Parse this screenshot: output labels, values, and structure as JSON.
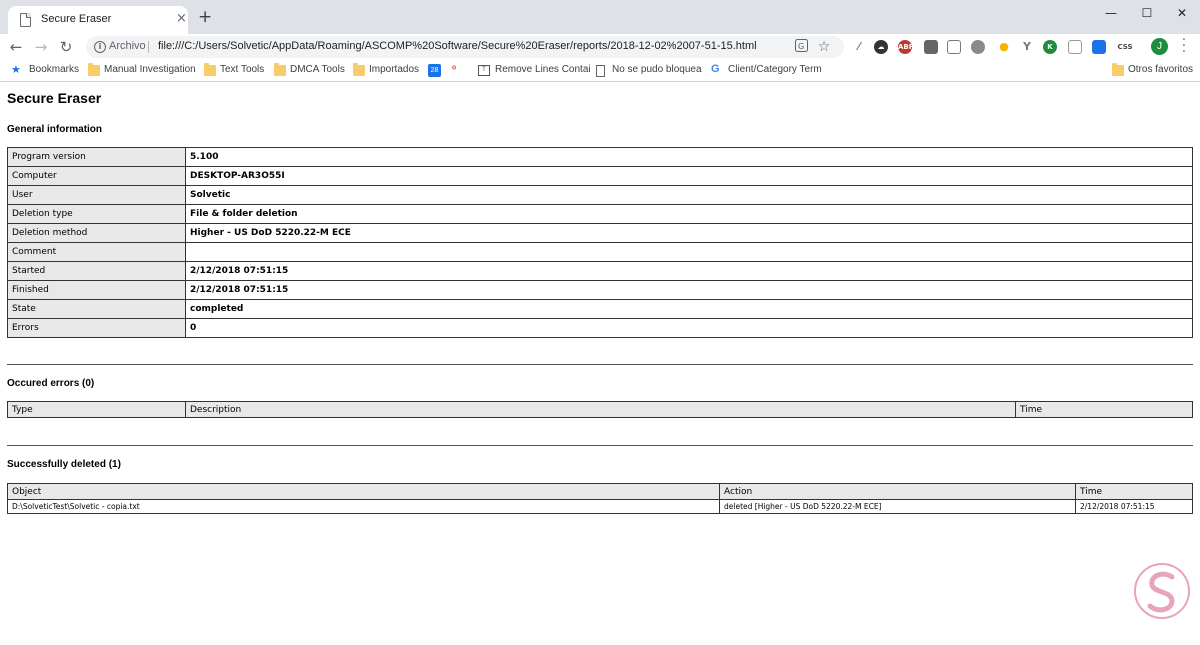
{
  "browser": {
    "tab_title": "Secure Eraser",
    "tab_close": "×",
    "new_tab": "+",
    "window_minimize": "—",
    "window_maximize": "☐",
    "window_close": "✕",
    "back": "←",
    "forward": "→",
    "reload": "↻",
    "url_scheme_label": "Archivo",
    "url": "file:///C:/Users/Solvetic/AppData/Roaming/ASCOMP%20Software/Secure%20Eraser/reports/2018-12-02%2007-51-15.html",
    "avatar_initial": "J",
    "extensions": [
      "ABP",
      "CSS"
    ]
  },
  "bookmarks": {
    "items": [
      {
        "label": "Bookmarks",
        "icon": "star-icon"
      },
      {
        "label": "Manual Investigation",
        "icon": "folder-icon"
      },
      {
        "label": "Text Tools",
        "icon": "folder-icon"
      },
      {
        "label": "DMCA Tools",
        "icon": "folder-icon"
      },
      {
        "label": "Importados",
        "icon": "folder-icon"
      },
      {
        "label": "28",
        "icon": "calendar-icon"
      },
      {
        "label": "",
        "icon": "monday-icon"
      },
      {
        "label": "Remove Lines Contai",
        "icon": "tool-icon"
      },
      {
        "label": "No se pudo bloquea",
        "icon": "page-icon"
      },
      {
        "label": "Client/Category Term",
        "icon": "google-icon"
      }
    ],
    "other": "Otros favoritos"
  },
  "page": {
    "title": "Secure Eraser",
    "general_heading": "General information",
    "general": [
      {
        "key": "Program version",
        "value": "5.100"
      },
      {
        "key": "Computer",
        "value": "DESKTOP-AR3O55I"
      },
      {
        "key": "User",
        "value": "Solvetic"
      },
      {
        "key": "Deletion type",
        "value": "File & folder deletion"
      },
      {
        "key": "Deletion method",
        "value": "Higher - US DoD 5220.22-M ECE"
      },
      {
        "key": "Comment",
        "value": ""
      },
      {
        "key": "Started",
        "value": "2/12/2018 07:51:15"
      },
      {
        "key": "Finished",
        "value": "2/12/2018 07:51:15"
      },
      {
        "key": "State",
        "value": "completed"
      },
      {
        "key": "Errors",
        "value": "0"
      }
    ],
    "errors_heading": "Occured errors (0)",
    "errors_columns": [
      "Type",
      "Description",
      "Time"
    ],
    "deleted_heading": "Successfully deleted (1)",
    "deleted_columns": [
      "Object",
      "Action",
      "Time"
    ],
    "deleted_rows": [
      [
        "D:\\SolveticTest\\Solvetic - copia.txt",
        "deleted [Higher - US DoD 5220.22-M ECE]",
        "2/12/2018 07:51:15"
      ]
    ]
  }
}
